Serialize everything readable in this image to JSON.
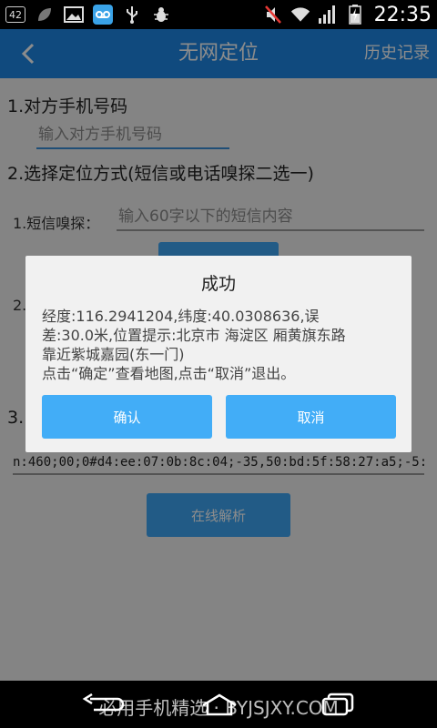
{
  "status_bar": {
    "notification_count": "42",
    "time": "22:35",
    "icons": [
      "leaf-icon",
      "image-icon",
      "voicemail-icon",
      "usb-icon",
      "debug-bug-icon",
      "mute-icon",
      "wifi-icon",
      "signal-icon",
      "battery-charging-icon"
    ]
  },
  "app_bar": {
    "title": "无网定位",
    "history_label": "历史记录",
    "color": "#1e88e5"
  },
  "form": {
    "step1_label": "1.对方手机号码",
    "phone_placeholder": "输入对方手机号码",
    "step2_label": "2.选择定位方式(短信或电话嗅探二选一)",
    "sms_sniff_label": "1.短信嗅探：",
    "sms_placeholder": "输入60字以下的短信内容",
    "option2_partial": "2.",
    "step3_partial": "3.",
    "result_value": "n:460;00;0#d4:ee:07:0b:8c:04;-35,50:bd:5f:58:27:a5;-5:",
    "parse_button_label": "在线解析"
  },
  "dialog": {
    "title": "成功",
    "message_line1": "经度:116.2941204,纬度:40.0308636,误",
    "message_line2": "差:30.0米,位置提示:北京市 海淀区 厢黄旗东路",
    "message_line3": "靠近紫城嘉园(东一门)",
    "message_line4": "点击“确定”查看地图,点击“取消”退出。",
    "confirm_label": "确认",
    "cancel_label": "取消",
    "button_color": "#42adf7"
  },
  "nav_bar": {
    "watermark": "必用手机精选 · BYJSJXY.COM"
  }
}
